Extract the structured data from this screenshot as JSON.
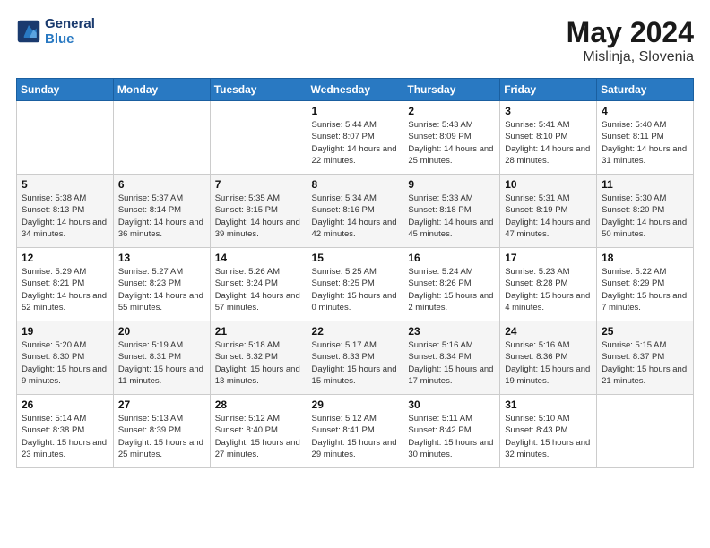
{
  "header": {
    "logo_line1": "General",
    "logo_line2": "Blue",
    "month_year": "May 2024",
    "location": "Mislinja, Slovenia"
  },
  "weekdays": [
    "Sunday",
    "Monday",
    "Tuesday",
    "Wednesday",
    "Thursday",
    "Friday",
    "Saturday"
  ],
  "weeks": [
    [
      {
        "day": "",
        "sunrise": "",
        "sunset": "",
        "daylight": ""
      },
      {
        "day": "",
        "sunrise": "",
        "sunset": "",
        "daylight": ""
      },
      {
        "day": "",
        "sunrise": "",
        "sunset": "",
        "daylight": ""
      },
      {
        "day": "1",
        "sunrise": "Sunrise: 5:44 AM",
        "sunset": "Sunset: 8:07 PM",
        "daylight": "Daylight: 14 hours and 22 minutes."
      },
      {
        "day": "2",
        "sunrise": "Sunrise: 5:43 AM",
        "sunset": "Sunset: 8:09 PM",
        "daylight": "Daylight: 14 hours and 25 minutes."
      },
      {
        "day": "3",
        "sunrise": "Sunrise: 5:41 AM",
        "sunset": "Sunset: 8:10 PM",
        "daylight": "Daylight: 14 hours and 28 minutes."
      },
      {
        "day": "4",
        "sunrise": "Sunrise: 5:40 AM",
        "sunset": "Sunset: 8:11 PM",
        "daylight": "Daylight: 14 hours and 31 minutes."
      }
    ],
    [
      {
        "day": "5",
        "sunrise": "Sunrise: 5:38 AM",
        "sunset": "Sunset: 8:13 PM",
        "daylight": "Daylight: 14 hours and 34 minutes."
      },
      {
        "day": "6",
        "sunrise": "Sunrise: 5:37 AM",
        "sunset": "Sunset: 8:14 PM",
        "daylight": "Daylight: 14 hours and 36 minutes."
      },
      {
        "day": "7",
        "sunrise": "Sunrise: 5:35 AM",
        "sunset": "Sunset: 8:15 PM",
        "daylight": "Daylight: 14 hours and 39 minutes."
      },
      {
        "day": "8",
        "sunrise": "Sunrise: 5:34 AM",
        "sunset": "Sunset: 8:16 PM",
        "daylight": "Daylight: 14 hours and 42 minutes."
      },
      {
        "day": "9",
        "sunrise": "Sunrise: 5:33 AM",
        "sunset": "Sunset: 8:18 PM",
        "daylight": "Daylight: 14 hours and 45 minutes."
      },
      {
        "day": "10",
        "sunrise": "Sunrise: 5:31 AM",
        "sunset": "Sunset: 8:19 PM",
        "daylight": "Daylight: 14 hours and 47 minutes."
      },
      {
        "day": "11",
        "sunrise": "Sunrise: 5:30 AM",
        "sunset": "Sunset: 8:20 PM",
        "daylight": "Daylight: 14 hours and 50 minutes."
      }
    ],
    [
      {
        "day": "12",
        "sunrise": "Sunrise: 5:29 AM",
        "sunset": "Sunset: 8:21 PM",
        "daylight": "Daylight: 14 hours and 52 minutes."
      },
      {
        "day": "13",
        "sunrise": "Sunrise: 5:27 AM",
        "sunset": "Sunset: 8:23 PM",
        "daylight": "Daylight: 14 hours and 55 minutes."
      },
      {
        "day": "14",
        "sunrise": "Sunrise: 5:26 AM",
        "sunset": "Sunset: 8:24 PM",
        "daylight": "Daylight: 14 hours and 57 minutes."
      },
      {
        "day": "15",
        "sunrise": "Sunrise: 5:25 AM",
        "sunset": "Sunset: 8:25 PM",
        "daylight": "Daylight: 15 hours and 0 minutes."
      },
      {
        "day": "16",
        "sunrise": "Sunrise: 5:24 AM",
        "sunset": "Sunset: 8:26 PM",
        "daylight": "Daylight: 15 hours and 2 minutes."
      },
      {
        "day": "17",
        "sunrise": "Sunrise: 5:23 AM",
        "sunset": "Sunset: 8:28 PM",
        "daylight": "Daylight: 15 hours and 4 minutes."
      },
      {
        "day": "18",
        "sunrise": "Sunrise: 5:22 AM",
        "sunset": "Sunset: 8:29 PM",
        "daylight": "Daylight: 15 hours and 7 minutes."
      }
    ],
    [
      {
        "day": "19",
        "sunrise": "Sunrise: 5:20 AM",
        "sunset": "Sunset: 8:30 PM",
        "daylight": "Daylight: 15 hours and 9 minutes."
      },
      {
        "day": "20",
        "sunrise": "Sunrise: 5:19 AM",
        "sunset": "Sunset: 8:31 PM",
        "daylight": "Daylight: 15 hours and 11 minutes."
      },
      {
        "day": "21",
        "sunrise": "Sunrise: 5:18 AM",
        "sunset": "Sunset: 8:32 PM",
        "daylight": "Daylight: 15 hours and 13 minutes."
      },
      {
        "day": "22",
        "sunrise": "Sunrise: 5:17 AM",
        "sunset": "Sunset: 8:33 PM",
        "daylight": "Daylight: 15 hours and 15 minutes."
      },
      {
        "day": "23",
        "sunrise": "Sunrise: 5:16 AM",
        "sunset": "Sunset: 8:34 PM",
        "daylight": "Daylight: 15 hours and 17 minutes."
      },
      {
        "day": "24",
        "sunrise": "Sunrise: 5:16 AM",
        "sunset": "Sunset: 8:36 PM",
        "daylight": "Daylight: 15 hours and 19 minutes."
      },
      {
        "day": "25",
        "sunrise": "Sunrise: 5:15 AM",
        "sunset": "Sunset: 8:37 PM",
        "daylight": "Daylight: 15 hours and 21 minutes."
      }
    ],
    [
      {
        "day": "26",
        "sunrise": "Sunrise: 5:14 AM",
        "sunset": "Sunset: 8:38 PM",
        "daylight": "Daylight: 15 hours and 23 minutes."
      },
      {
        "day": "27",
        "sunrise": "Sunrise: 5:13 AM",
        "sunset": "Sunset: 8:39 PM",
        "daylight": "Daylight: 15 hours and 25 minutes."
      },
      {
        "day": "28",
        "sunrise": "Sunrise: 5:12 AM",
        "sunset": "Sunset: 8:40 PM",
        "daylight": "Daylight: 15 hours and 27 minutes."
      },
      {
        "day": "29",
        "sunrise": "Sunrise: 5:12 AM",
        "sunset": "Sunset: 8:41 PM",
        "daylight": "Daylight: 15 hours and 29 minutes."
      },
      {
        "day": "30",
        "sunrise": "Sunrise: 5:11 AM",
        "sunset": "Sunset: 8:42 PM",
        "daylight": "Daylight: 15 hours and 30 minutes."
      },
      {
        "day": "31",
        "sunrise": "Sunrise: 5:10 AM",
        "sunset": "Sunset: 8:43 PM",
        "daylight": "Daylight: 15 hours and 32 minutes."
      },
      {
        "day": "",
        "sunrise": "",
        "sunset": "",
        "daylight": ""
      }
    ]
  ]
}
